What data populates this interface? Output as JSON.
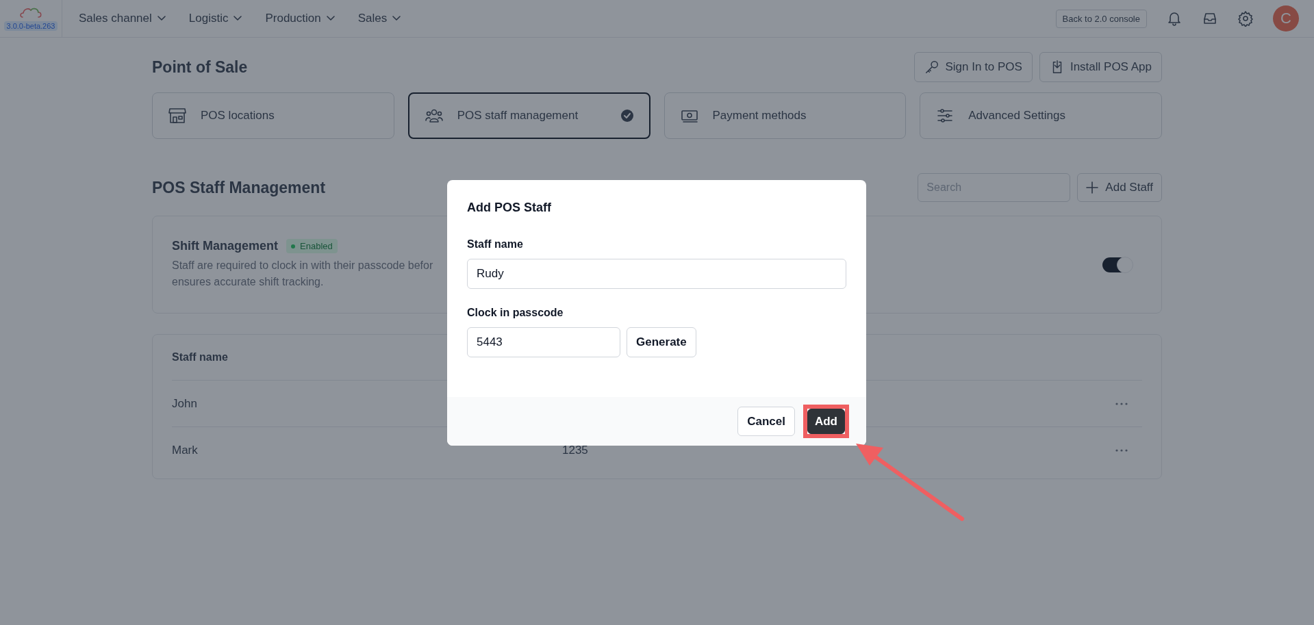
{
  "header": {
    "version_badge": "3.0.0-beta.263",
    "nav": [
      {
        "label": "Sales channel"
      },
      {
        "label": "Logistic"
      },
      {
        "label": "Production"
      },
      {
        "label": "Sales"
      }
    ],
    "back_button": "Back to 2.0 console",
    "avatar_initial": "C"
  },
  "page": {
    "title": "Point of Sale",
    "actions": [
      {
        "label": "Sign In to POS",
        "kind": "key"
      },
      {
        "label": "Install POS App",
        "kind": "install"
      }
    ],
    "sections": [
      {
        "label": "POS locations",
        "kind": "store",
        "selected": false
      },
      {
        "label": "POS staff management",
        "kind": "people",
        "selected": true
      },
      {
        "label": "Payment methods",
        "kind": "money",
        "selected": false
      },
      {
        "label": "Advanced Settings",
        "kind": "sliders",
        "selected": false
      }
    ]
  },
  "staff": {
    "title": "POS Staff Management",
    "search": {
      "placeholder": "Search"
    },
    "add_button": "Add Staff",
    "shift": {
      "title": "Shift Management",
      "badge": "Enabled",
      "description_lines": [
        "Staff are required to clock in with their passcode befor",
        "ensures accurate shift tracking."
      ],
      "on": true
    },
    "table": {
      "columns": [
        "Staff name"
      ],
      "rows": [
        {
          "cells": [
            "John"
          ]
        },
        {
          "cells": [
            "Mark",
            "1235"
          ]
        }
      ]
    }
  },
  "modal": {
    "title": "Add POS Staff",
    "name_label": "Staff name",
    "name_value": "Rudy",
    "passcode_label": "Clock in passcode",
    "passcode_value": "5443",
    "generate_button": "Generate",
    "buttons": [
      {
        "label": "Cancel",
        "kind": "secondary"
      },
      {
        "label": "Add",
        "kind": "primary",
        "highlighted": true
      }
    ]
  }
}
